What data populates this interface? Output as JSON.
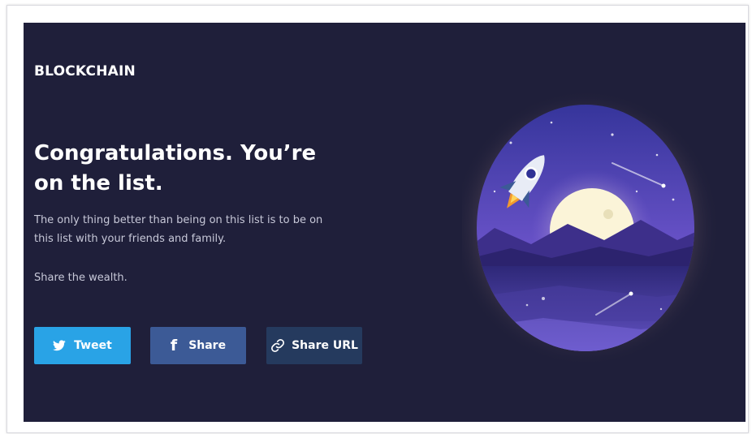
{
  "brand": {
    "name": "BLOCKCHAIN"
  },
  "main": {
    "headline": "Congratulations. You’re on the list.",
    "description": "The only thing better than being on this list is to be on this list with your friends and family.",
    "share_prompt": "Share the wealth."
  },
  "buttons": {
    "tweet": {
      "label": "Tweet",
      "icon": "twitter-bird-icon"
    },
    "share": {
      "label": "Share",
      "icon": "facebook-icon"
    },
    "share_url": {
      "label": "Share URL",
      "icon": "link-icon"
    }
  },
  "illustration": {
    "name": "rocket-moon-night-sky",
    "colors": {
      "sky_top": "#3a3aa8",
      "sky_bottom": "#8b67d6",
      "moon": "#fbf4d8",
      "water": "#3b2f8a",
      "glow": "#5a4a5a"
    }
  },
  "colors": {
    "panel_background": "#1f1f3a",
    "tweet_button": "#29a3e6",
    "share_button": "#3c5a96",
    "share_url_button": "#253a5e"
  }
}
